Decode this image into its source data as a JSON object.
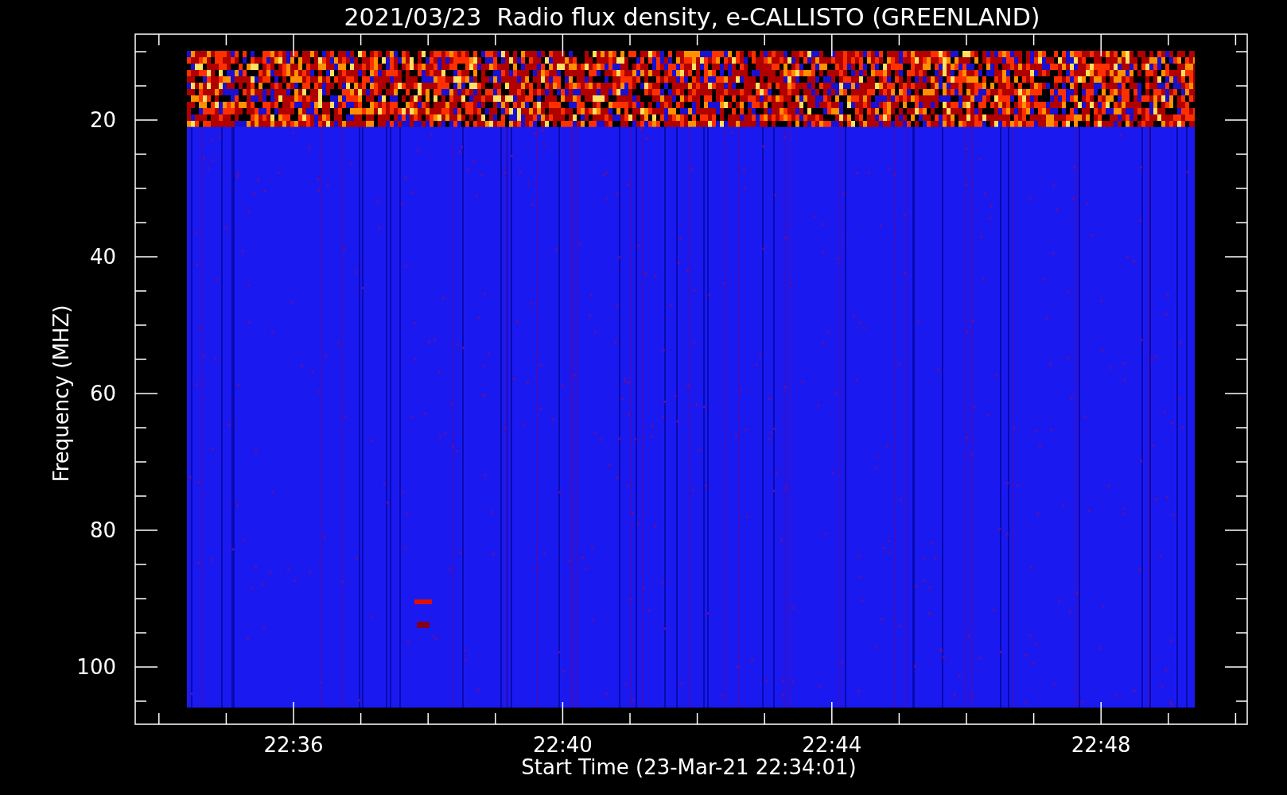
{
  "title": "2021/03/23  Radio flux density, e-CALLISTO (GREENLAND)",
  "y_axis": {
    "label": "Frequency (MHZ)",
    "tick_labels": [
      "20",
      "40",
      "60",
      "80",
      "100"
    ]
  },
  "x_axis": {
    "label": "Start Time (23-Mar-21 22:34:01)",
    "tick_labels": [
      "22:36",
      "22:40",
      "22:44",
      "22:48"
    ]
  }
}
